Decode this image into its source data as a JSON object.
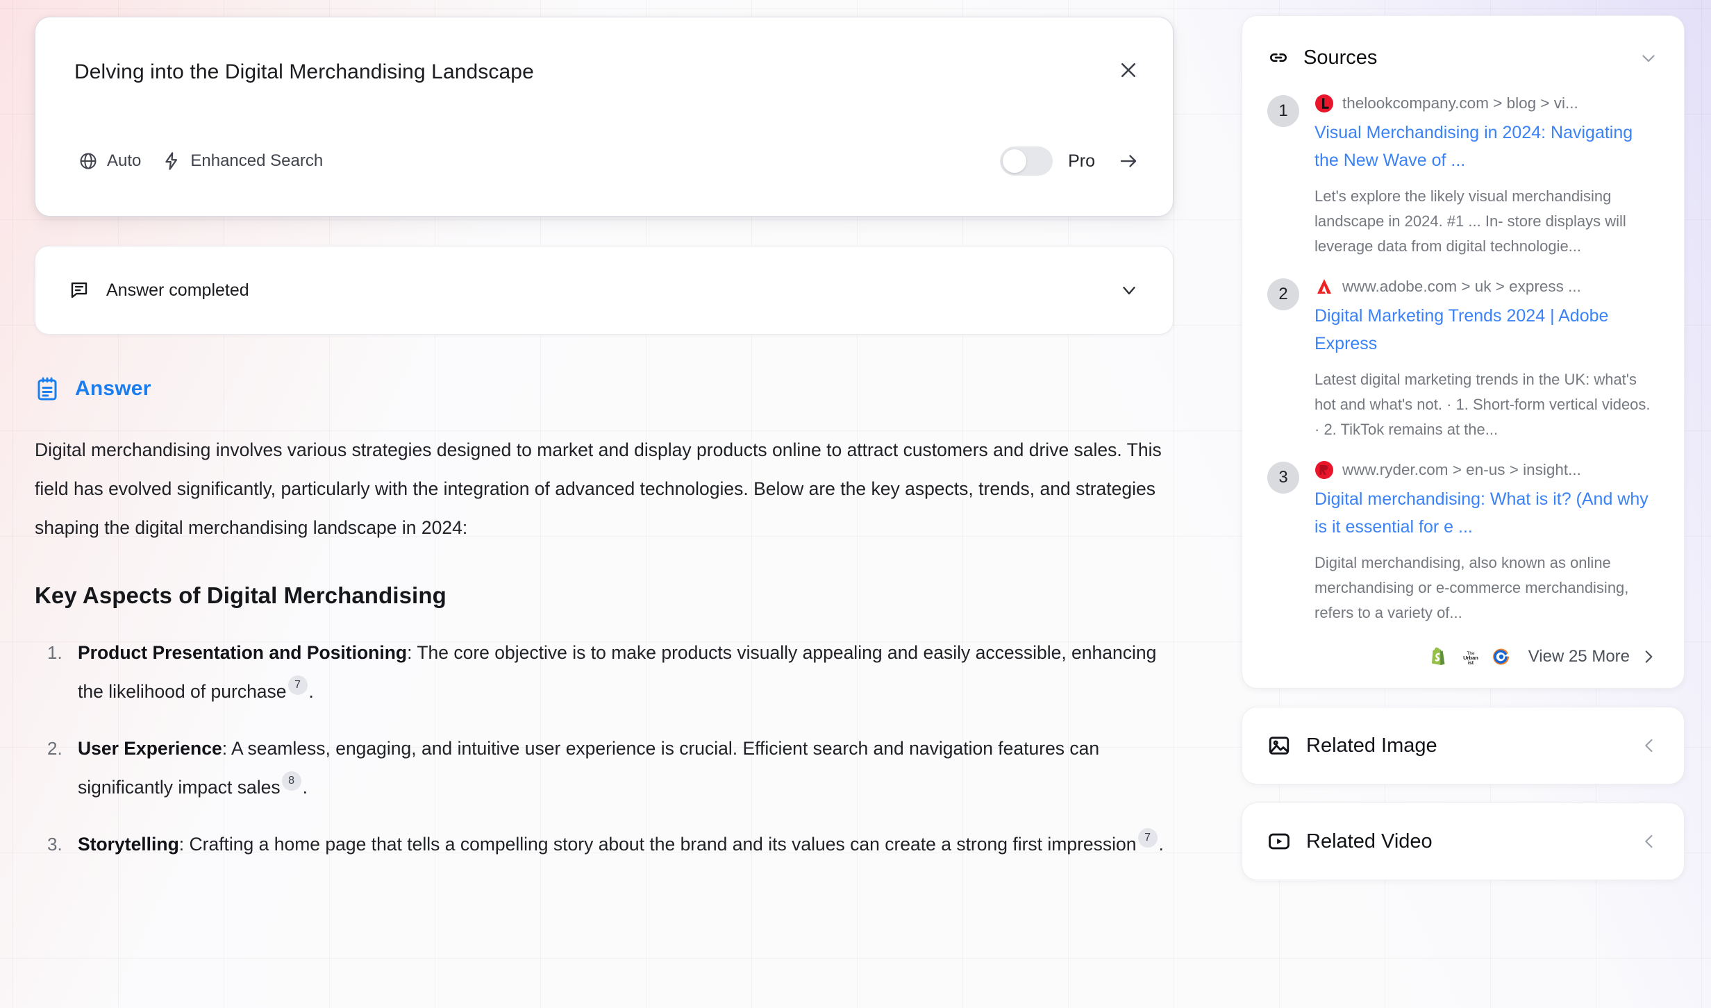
{
  "search": {
    "query": "Delving into the Digital Merchandising Landscape",
    "close_label": "×",
    "mode_label": "Auto",
    "enhanced_label": "Enhanced Search",
    "pro_label": "Pro",
    "pro_enabled": false
  },
  "status": {
    "label": "Answer completed"
  },
  "answer": {
    "title": "Answer",
    "paragraph": "Digital merchandising involves various strategies designed to market and display products online to attract customers and drive sales. This field has evolved significantly, particularly with the integration of advanced technologies. Below are the key aspects, trends, and strategies shaping the digital merchandising landscape in 2024:",
    "heading": "Key Aspects of Digital Merchandising",
    "items": [
      {
        "term": "Product Presentation and Positioning",
        "text": ": The core objective is to make products visually appealing and easily accessible, enhancing the likelihood of purchase",
        "citation": "7",
        "tail": "."
      },
      {
        "term": "User Experience",
        "text": ": A seamless, engaging, and intuitive user experience is crucial. Efficient search and navigation features can significantly impact sales",
        "citation": "8",
        "tail": "."
      },
      {
        "term": "Storytelling",
        "text": ": Crafting a home page that tells a compelling story about the brand and its values can create a strong first impression",
        "citation": "7",
        "tail": "."
      }
    ]
  },
  "sources": {
    "title": "Sources",
    "items": [
      {
        "num": "1",
        "url": "thelookcompany.com > blog > vi...",
        "title": "Visual Merchandising in 2024: Navigating the New Wave of ...",
        "snippet": "Let's explore the likely visual merchandising landscape in 2024. #1 ... In- store displays will leverage data from digital technologie...",
        "favicon": "thelookcompany-favicon",
        "favicon_color": "#e8152b"
      },
      {
        "num": "2",
        "url": "www.adobe.com > uk > express ...",
        "title": "Digital Marketing Trends 2024 | Adobe Express",
        "snippet": "Latest digital marketing trends in the UK: what's hot and what's not. · 1. Short-form vertical videos. · 2. TikTok remains at the...",
        "favicon": "adobe-favicon",
        "favicon_color": "#ed2224"
      },
      {
        "num": "3",
        "url": "www.ryder.com > en-us > insight...",
        "title": "Digital merchandising: What is it? (And why is it essential for e ...",
        "snippet": "Digital merchandising, also known as online merchandising or e-commerce merchandising, refers to a variety of...",
        "favicon": "ryder-favicon",
        "favicon_color": "#e8152b"
      }
    ],
    "view_more_label": "View 25 More",
    "more_favicons": [
      "shopify-favicon",
      "theurbanist-favicon",
      "cquence-favicon"
    ]
  },
  "related_image": {
    "title": "Related Image"
  },
  "related_video": {
    "title": "Related Video"
  },
  "colors": {
    "accent_blue": "#1a7ef0",
    "link_blue": "#3b82f6",
    "muted_text": "#74787f"
  }
}
